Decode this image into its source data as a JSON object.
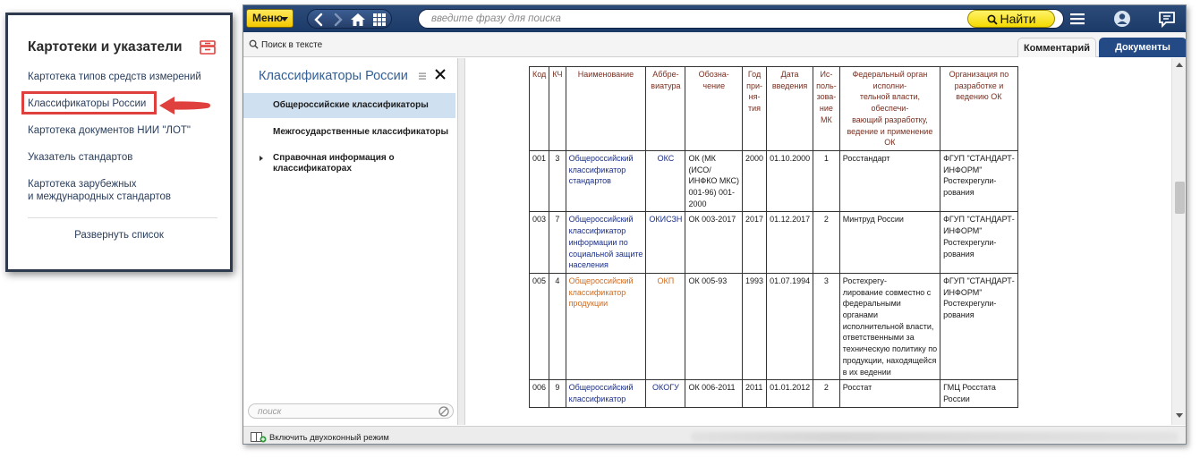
{
  "card": {
    "title": "Картотеки и указатели",
    "items": [
      "Картотека типов средств измерений",
      "Классификаторы России",
      "Картотека документов НИИ \"ЛОТ\"",
      "Указатель стандартов",
      "Картотека зарубежных",
      "и международных стандартов"
    ],
    "selected_index": 1,
    "expand_label": "Развернуть список",
    "accent_color": "#e0403d",
    "icon": "archive-icon"
  },
  "toolbar": {
    "menu_label": "Меню",
    "search_placeholder": "введите фразу для поиска",
    "find_label": "Найти",
    "icons": [
      "back-icon",
      "forward-icon",
      "home-icon",
      "grid-icon",
      "hamburger-icon",
      "user-icon",
      "feedback-icon"
    ]
  },
  "tabs": {
    "find_in_text": "Поиск в тексте",
    "comment": "Комментарий",
    "documents": "Документы",
    "active": "documents"
  },
  "left_panel": {
    "title": "Классификаторы России",
    "items": [
      "Общероссийские классификаторы",
      "Межгосударственные классификаторы",
      "Справочная информация о",
      "классификаторах"
    ],
    "selected_index": 0,
    "search_placeholder": "поиск"
  },
  "table": {
    "headers": [
      {
        "lines": [
          "Код"
        ]
      },
      {
        "lines": [
          "КЧ"
        ]
      },
      {
        "lines": [
          "Наименование"
        ]
      },
      {
        "lines": [
          "Аббре-",
          "виатура"
        ]
      },
      {
        "lines": [
          "Обозна-",
          "чение"
        ]
      },
      {
        "lines": [
          "Год",
          "при-",
          "ня-",
          "тия"
        ]
      },
      {
        "lines": [
          "Дата",
          "введения"
        ]
      },
      {
        "lines": [
          "Ис-",
          "поль-",
          "зова-",
          "ние",
          "МК"
        ]
      },
      {
        "lines": [
          "Федеральный орган",
          "исполни-",
          "тельной власти,",
          "обеспечи-",
          "вающий разработку,",
          "ведение и применение",
          "ОК"
        ]
      },
      {
        "lines": [
          "Организация по",
          "разработке и",
          "ведению ОК"
        ]
      }
    ],
    "rows": [
      {
        "code": "001",
        "kch": "3",
        "name_lines": [
          "Общероссийский",
          "классификатор",
          "стандартов"
        ],
        "abbr": "ОКС",
        "designation_lines": [
          "ОК (МК",
          "(ИСО/",
          "ИНФКО МКС)",
          "001-96) 001-",
          "2000"
        ],
        "year": "2000",
        "date": "01.10.2000",
        "mk": "1",
        "federal_lines": [
          "Росстандарт"
        ],
        "org_lines": [
          "ФГУП \"СТАНДАРТ-",
          "ИНФОРМ\"",
          "Ростехрегули-",
          "рования"
        ],
        "highlight": false
      },
      {
        "code": "003",
        "kch": "7",
        "name_lines": [
          "Общероссийский",
          "классификатор",
          "информации по",
          "социальной защите",
          "населения"
        ],
        "abbr": "ОКИСЗН",
        "designation_lines": [
          "ОК 003-2017"
        ],
        "year": "2017",
        "date": "01.12.2017",
        "mk": "2",
        "federal_lines": [
          "Минтруд России"
        ],
        "org_lines": [
          " ФГУП \"СТАНДАРТ-",
          "ИНФОРМ\"",
          "Ростехрегули-",
          "рования"
        ],
        "highlight": false
      },
      {
        "code": "005",
        "kch": "4",
        "name_lines": [
          "Общероссийский",
          "классификатор",
          "продукции"
        ],
        "abbr": "ОКП",
        "designation_lines": [
          "ОК 005-93"
        ],
        "year": "1993",
        "date": "01.07.1994",
        "mk": "3",
        "federal_lines": [
          "Ростехрегу-",
          "лирование совместно с",
          "федеральными",
          "органами",
          "исполнительной власти,",
          "ответственными за",
          "техническую политику по",
          "продукции, находящейся",
          "в их ведении"
        ],
        "org_lines": [
          "ФГУП \"СТАНДАРТ-",
          "ИНФОРМ\"",
          "Ростехрегули-",
          "рования"
        ],
        "highlight": true
      },
      {
        "code": "006",
        "kch": "9",
        "name_lines": [
          "Общероссийский",
          "классификатор"
        ],
        "abbr": "ОКОГУ",
        "designation_lines": [
          "ОК 006-2011"
        ],
        "year": "2011",
        "date": "01.01.2012",
        "mk": "2",
        "federal_lines": [
          "Росстат"
        ],
        "org_lines": [
          "ГМЦ Росстата",
          "России"
        ],
        "highlight": false
      }
    ],
    "link_color": "#1a2f8a",
    "highlight_color": "#d06b1f",
    "header_color": "#7a2e1f"
  },
  "statusbar": {
    "two_window_label": "Включить двухоконный режим"
  }
}
